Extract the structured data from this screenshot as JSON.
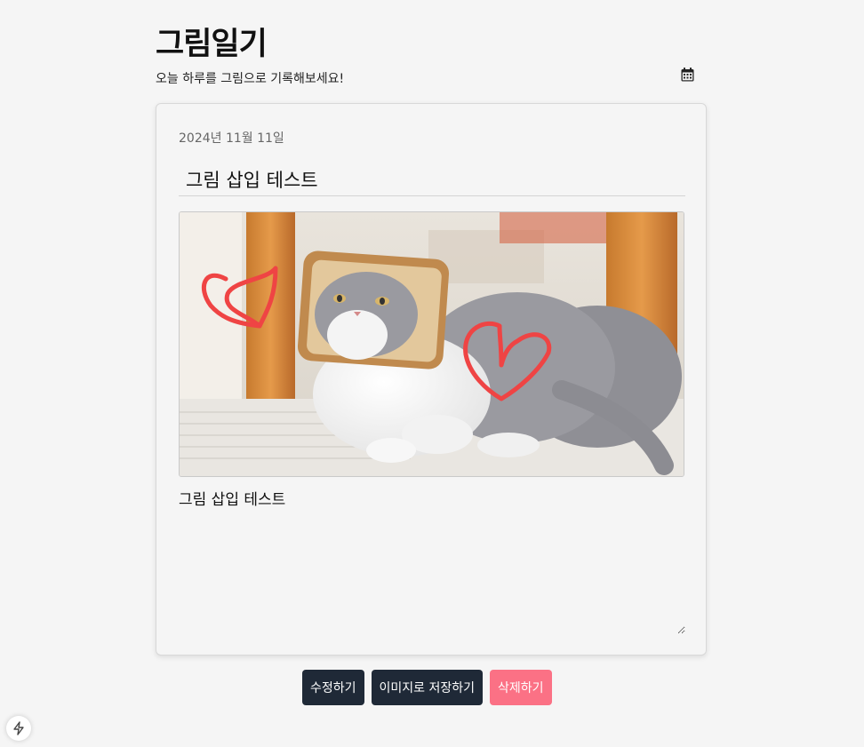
{
  "header": {
    "title": "그림일기",
    "subtitle": "오늘 하루를 그림으로 기록해보세요!",
    "calendar_icon": "calendar-icon"
  },
  "entry": {
    "date": "2024년 11월 11일",
    "title_value": "그림 삽입 테스트",
    "content_value": "그림 삽입 테스트",
    "drawing": {
      "subject": "photo of a grey-and-white cat wearing a slice of bread around its face",
      "doodle": "two hand-drawn red hearts",
      "doodle_color": "#ef4444"
    }
  },
  "actions": {
    "edit_label": "수정하기",
    "save_image_label": "이미지로 저장하기",
    "delete_label": "삭제하기"
  },
  "colors": {
    "dark_button": "#1f2937",
    "delete_button": "#fb7185",
    "background": "#f5f5f5"
  },
  "dev_indicator": {
    "icon": "lightning-bolt-icon"
  }
}
